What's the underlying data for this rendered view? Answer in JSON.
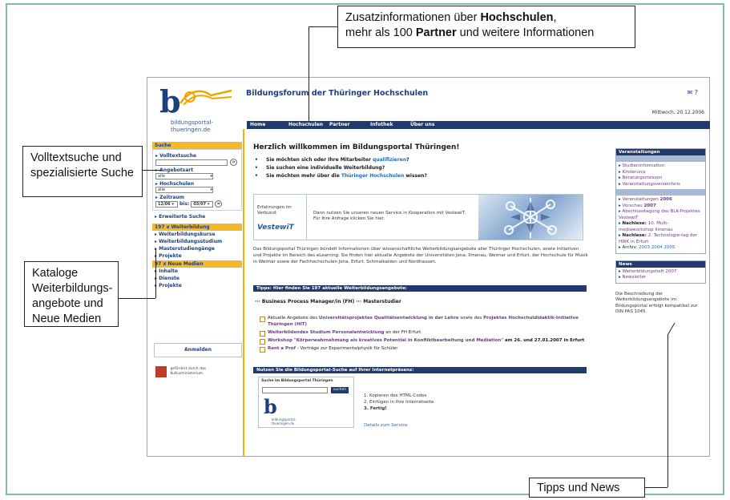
{
  "callouts": {
    "top_line1_a": "Zusatzinformationen über ",
    "top_line1_b": "Hochschulen",
    "top_line1_c": ",",
    "top_line2_a": "mehr als 100 ",
    "top_line2_b": "Partner",
    "top_line2_c": " und weitere Informationen",
    "search": "Volltextsuche und spezialisierte Suche",
    "catalog": "Kataloge Weiterbildungs-angebote und Neue Medien",
    "news": "Tipps und News"
  },
  "site": {
    "logo_text_1": "bildungsportal-",
    "logo_text_2": "thueringen.de",
    "title": "Bildungsforum der Thüringer Hochschulen",
    "icons": "✉  ?",
    "date": "Mittwoch, 20.12.2006",
    "nav": [
      "Home",
      "Hochschulen",
      "Partner",
      "Infothek",
      "Über uns"
    ]
  },
  "sidebar": {
    "suche": "Suche",
    "volltextsuche": "Volltextsuche",
    "angebotsart": "Angebotsart",
    "angebotsart_value": "alle",
    "hochschulen": "Hochschulen",
    "hochschulen_value": "alle",
    "zeitraum": "Zeitraum",
    "zeit_from": "12/06",
    "zeit_bis": "bis:",
    "zeit_to": "03/07",
    "erweiterte": "Erweiterte Suche",
    "weiterbildung_head": "197 x Weiterbildung",
    "wb_items": [
      "Weiterbildungskurse",
      "Weiterbildungsstudium",
      "Masterstudiengänge",
      "Projekte"
    ],
    "medien_head": "97 x Neue Medien",
    "nm_items": [
      "Inhalte",
      "Dienste",
      "Projekte"
    ],
    "anmelden": "Anmelden",
    "gefoerdert_1": "gefördert durch das",
    "gefoerdert_2": "Kultusministerium"
  },
  "main": {
    "welcome": "Herzlich willkommen im Bildungsportal Thüringen!",
    "q1_a": "Sie möchten sich oder Ihre Mitarbeiter ",
    "q1_b": "qualifizieren",
    "q1_c": "?",
    "q2": "Sie suchen eine individuelle Weiterbildung?",
    "q3_a": "Sie möchten mehr über die ",
    "q3_b": "Thüringer Hochschulen",
    "q3_c": " wissen?",
    "vw_left": "Erfahrungen im Verbund:",
    "vw_logo": "VestewiT",
    "vw_text": "Dann nutzen Sie unseren neuen Service in Kooperation mit VestewiT. Für Ihre Anfrage klicken Sie hier.",
    "para": "Das Bildungsportal Thüringen bündelt Informationen über wissenschaftliche Weiterbildungsangebote aller Thüringer Hochschulen, sowie Initiativen und Projekte im Bereich des eLearning. Sie finden hier aktuelle Angebote der Universitäten Jena, Ilmenau, Weimar und Erfurt, der Hochschule für Musik in Weimar sowie der Fachhochschulen Jena, Erfurt, Schmalkalden und Nordhausen.",
    "tipps_bar": "Tipps: Hier finden Sie 197 aktuelle Weiterbildungsangebote:",
    "bpm": "···  Business Process Manager/in (FH)    ···   Masterstudier",
    "offers": [
      {
        "a": "Aktuelle Angebote des ",
        "b": "Universitätsprojektes Qualitätsentwicklung in der Lehre",
        "c": " sowie des ",
        "d": "Projektes Hochschuldidaktik-Initiative Thüringen (HIT)"
      },
      {
        "a": "",
        "b": "Weiterbildendes Studium Personalentwicklung",
        "c": "  an der FH Erfurt",
        "d": ""
      },
      {
        "a": "",
        "b": "Workshop \"Körperwahrnehmung als kreatives Potential in Konfliktbearbeitung und Mediation\"",
        "c": "  am 26. und 27.01.2007 in Erfurt",
        "d": ""
      },
      {
        "a": "",
        "b": "Rent a Prof",
        "c": " - Vorträge zur Experimentalphysik für Schüler",
        "d": ""
      }
    ],
    "nutzen_bar": "Nutzen Sie die Bildungsportal-Suche auf Ihrer Internetpräsenz:",
    "widget_title": "Suche im Bildungsportal Thüringen",
    "widget_btn": "suchen",
    "widget_logo_1": "bildungsportal-",
    "widget_logo_2": "thueringen.de",
    "step1": "1. Kopieren des HTML-Codes",
    "step2": "2. Einfügen in Ihre Internetseite",
    "step3": "3. Fertig!",
    "service": "Details zum Service"
  },
  "right": {
    "veranstaltungen": "Veranstaltungen",
    "v_items": [
      "Studieninformation",
      "Kinderunis",
      "Beratungsmessen",
      "Veranstaltungsverzeichnis"
    ],
    "v2_items": [
      {
        "a": "Veranstaltungen ",
        "b": "2006"
      },
      {
        "a": "Vorschau ",
        "b": "2007"
      },
      {
        "a": "Abschlusstagung des BLK-Projektes VestewiT",
        "b": ""
      },
      {
        "a": "Nachlese: ",
        "b": "10. Multi-mediaworkshop Ilmenau"
      },
      {
        "a": "Nachlese: ",
        "b": "2. Technologie-tag der HWK in Erfurt"
      },
      {
        "a": "Archiv: ",
        "b": "2003 2004 2005"
      }
    ],
    "news": "News",
    "news_items": [
      "Weiterbildungsheft 2007",
      "Newsletter"
    ],
    "note": "Die Beschreibung der Weiterbildungsangebote im Bildungsportal erfolgt kompatibel zur DIN PAS 1045."
  }
}
